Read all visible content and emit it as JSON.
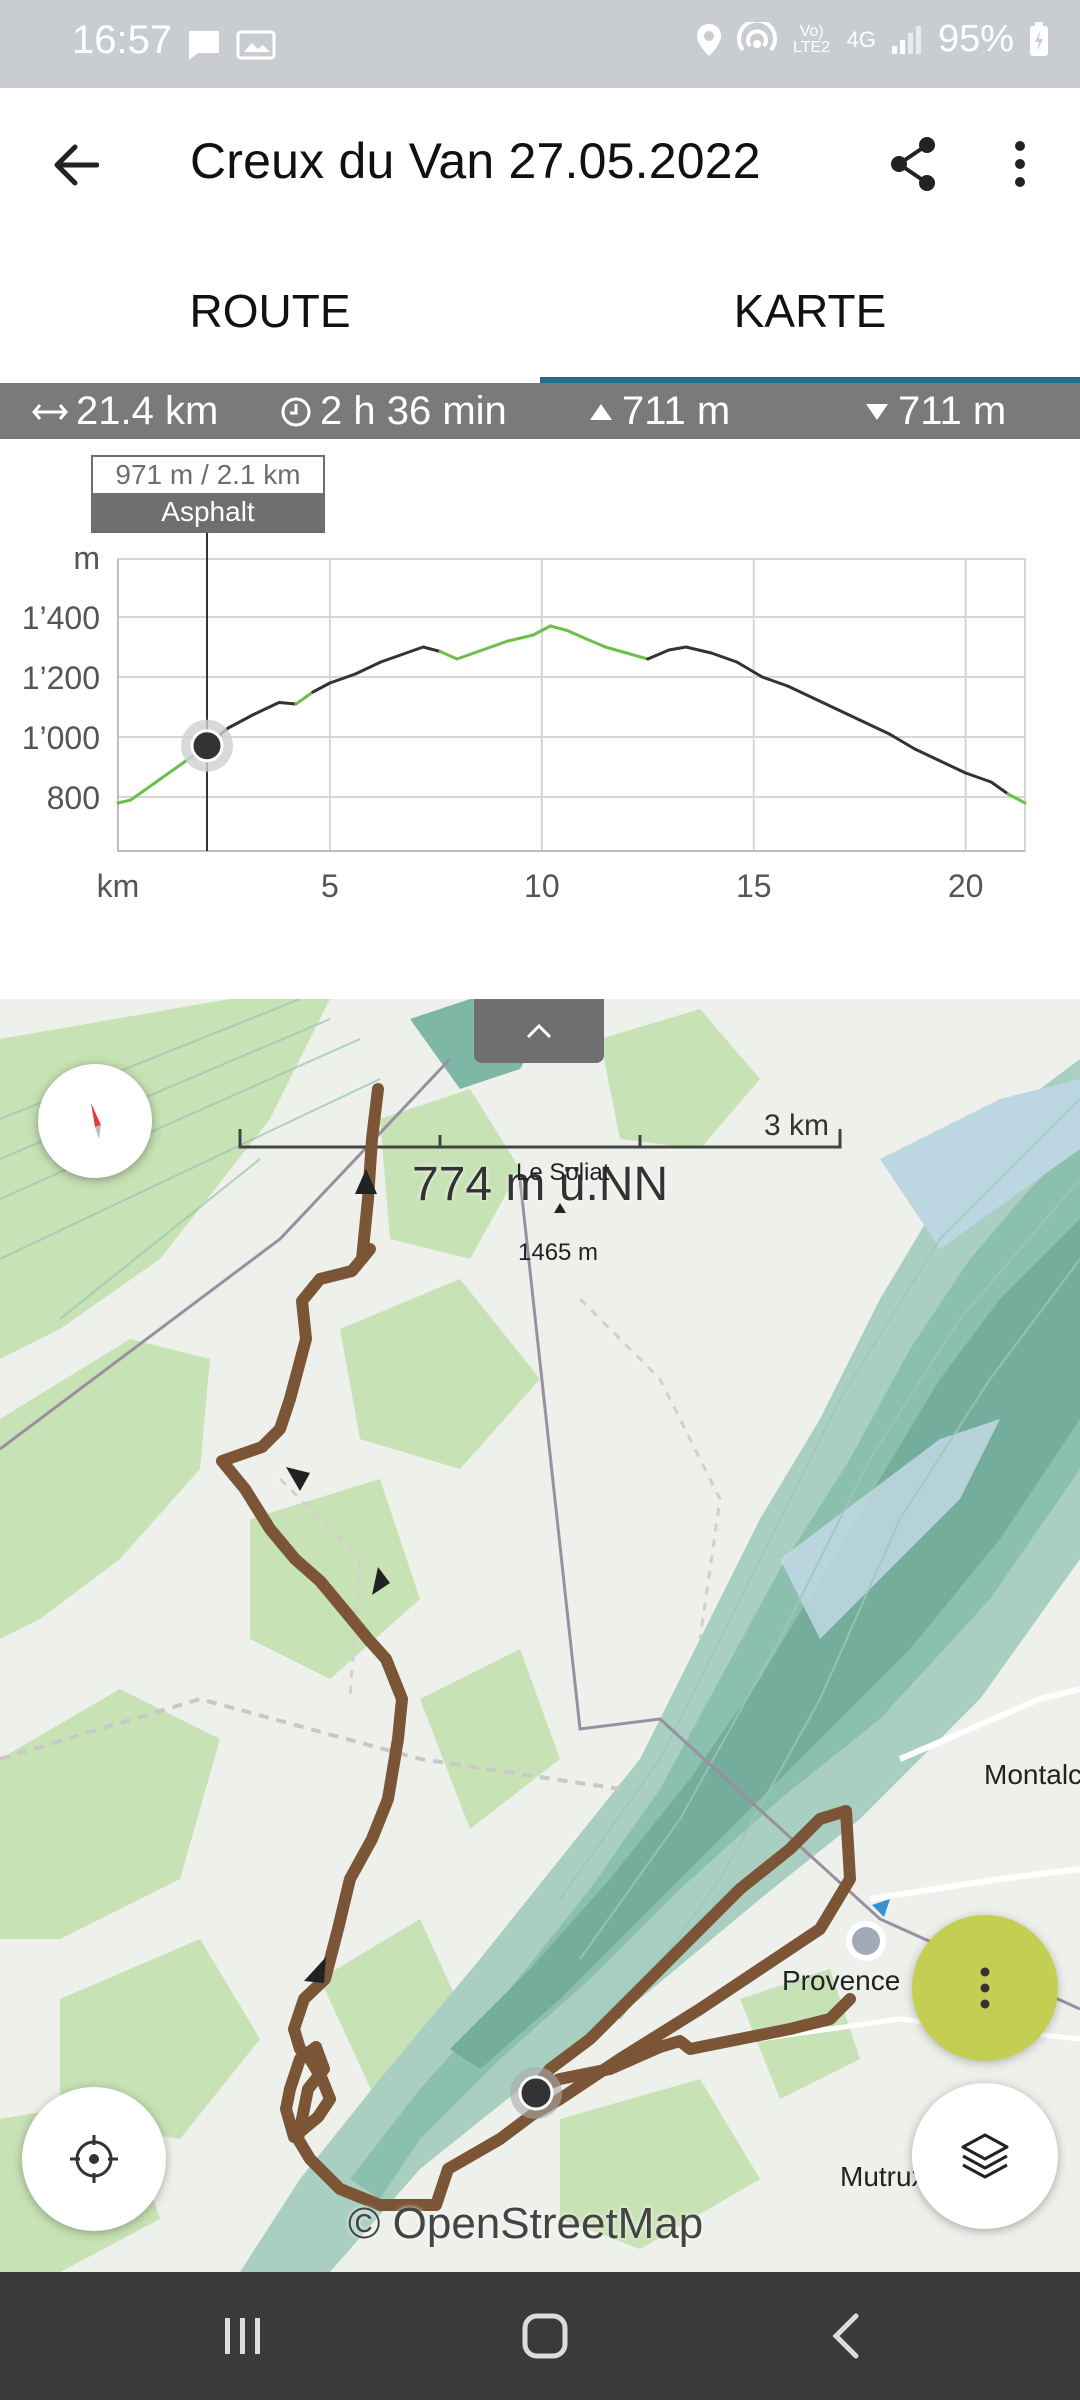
{
  "status_bar": {
    "time": "16:57",
    "battery": "95%",
    "network_badge": "Vo) LTE2",
    "network": "4G",
    "icons": [
      "chat-icon",
      "gallery-icon",
      "location-icon",
      "hotspot-icon",
      "volte-icon",
      "mobile-data-icon",
      "signal-icon",
      "battery-charging-icon"
    ]
  },
  "header": {
    "title": "Creux du Van 27.05.2022",
    "back_icon": "arrow-left-icon",
    "share_icon": "share-icon",
    "more_icon": "more-vertical-icon"
  },
  "tabs": [
    {
      "label": "ROUTE",
      "active": false
    },
    {
      "label": "KARTE",
      "active": true
    }
  ],
  "stats": {
    "distance": "21.4 km",
    "duration": "2 h 36 min",
    "ascent": "711 m",
    "descent": "711 m"
  },
  "chart_data": {
    "type": "line",
    "title": "",
    "xlabel": "km",
    "ylabel": "m",
    "xlim": [
      0,
      21.4
    ],
    "ylim": [
      700,
      1500
    ],
    "x_ticks": [
      5,
      10,
      15,
      20
    ],
    "y_ticks": [
      800,
      1000,
      1200,
      1400
    ],
    "y_tick_labels": [
      "800",
      "1’000",
      "1’200",
      "1’400"
    ],
    "grid": true,
    "series": [
      {
        "x": [
          0,
          0.3,
          0.6,
          1.0,
          1.5,
          2.1,
          2.6,
          3.2,
          3.8,
          4.2,
          4.6,
          5.0,
          5.6,
          6.2,
          6.8,
          7.2,
          7.6,
          8.0,
          8.6,
          9.2,
          9.8,
          10.2,
          10.6,
          11.0,
          11.5,
          12.0,
          12.5,
          13.0,
          13.4,
          14.0,
          14.6,
          15.2,
          15.8,
          16.4,
          17.0,
          17.6,
          18.2,
          18.8,
          19.4,
          20.0,
          20.6,
          21.0,
          21.4
        ],
        "y": [
          780,
          790,
          820,
          860,
          910,
          971,
          1030,
          1075,
          1115,
          1110,
          1150,
          1180,
          1210,
          1250,
          1280,
          1300,
          1285,
          1260,
          1290,
          1320,
          1340,
          1370,
          1355,
          1330,
          1300,
          1280,
          1260,
          1290,
          1300,
          1280,
          1250,
          1200,
          1170,
          1130,
          1090,
          1050,
          1010,
          960,
          920,
          880,
          850,
          810,
          780
        ]
      }
    ],
    "marker": {
      "x": 2.1,
      "y": 971
    },
    "tooltip": {
      "value": "971 m / 2.1 km",
      "surface": "Asphalt"
    }
  },
  "map": {
    "handle_icon": "chevron-up-icon",
    "compass_icon": "compass-icon",
    "scale_label": "3 km",
    "elevation_label": "774 m ü.NN",
    "peak_name": "Le Soliat",
    "peak_height": "1465 m",
    "places": {
      "montalchez": "Montalch",
      "provence": "Provence",
      "mutrux": "Mutrux"
    },
    "attribution": "© OpenStreetMap",
    "route_color": "#7b5536",
    "locate_icon": "crosshair-icon",
    "more_icon": "more-vertical-icon",
    "layers_icon": "layers-icon",
    "fab_color": "#c4ce53"
  },
  "nav_bar": {
    "recents_icon": "recents-icon",
    "home_icon": "home-icon",
    "back_icon": "back-icon"
  }
}
